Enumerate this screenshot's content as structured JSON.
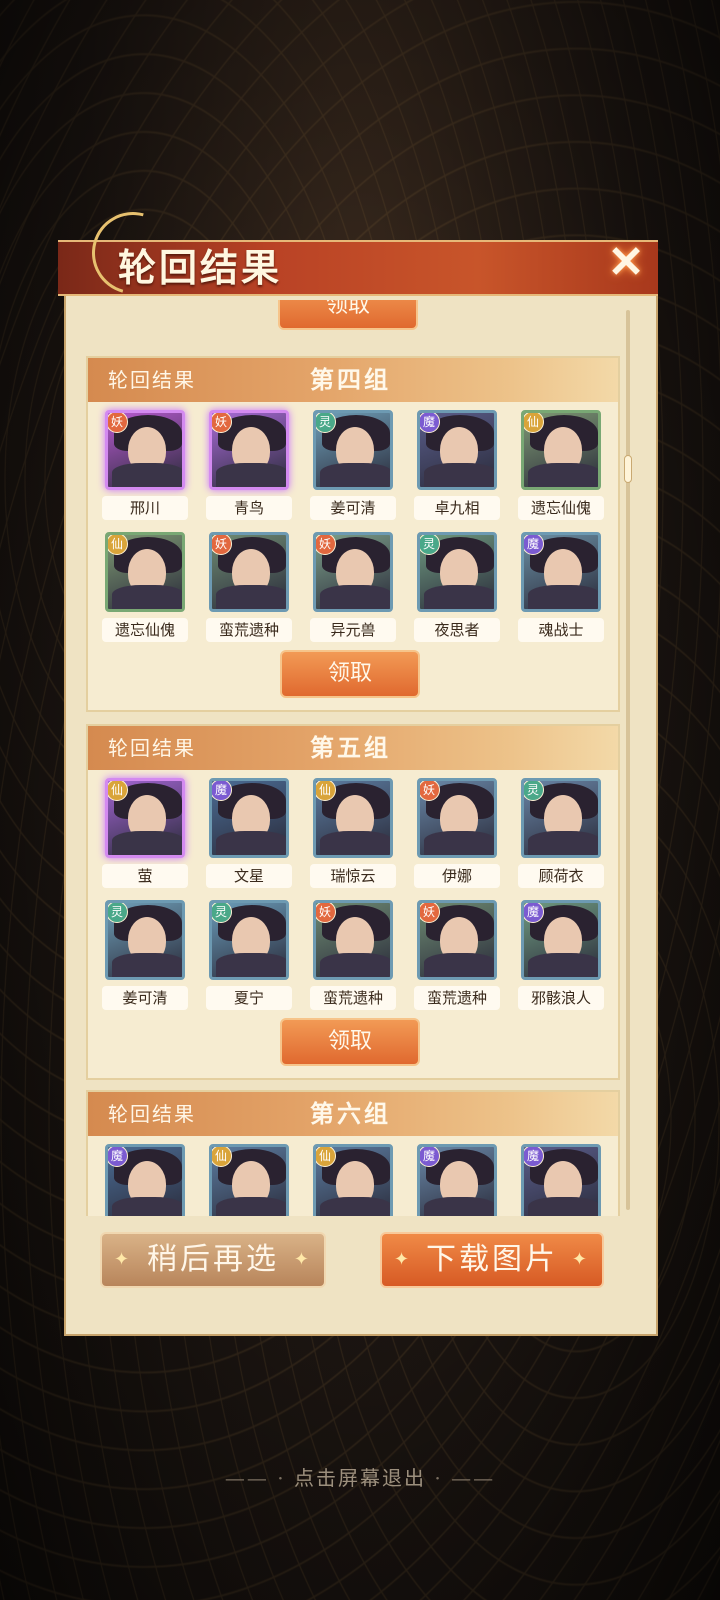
{
  "dialog": {
    "title": "轮回结果",
    "close_icon": "close-icon",
    "prev_button_label": "领取"
  },
  "groups": [
    {
      "label": "轮回结果",
      "name": "第四组",
      "claim_label": "领取",
      "members": [
        {
          "name": "邢川",
          "badge": "妖",
          "color": "#b75ad0"
        },
        {
          "name": "青鸟",
          "badge": "妖",
          "color": "#a86ad6"
        },
        {
          "name": "姜可清",
          "badge": "灵",
          "color": "#6f9fb8"
        },
        {
          "name": "卓九相",
          "badge": "魔",
          "color": "#5a5d8a"
        },
        {
          "name": "遗忘仙傀",
          "badge": "仙",
          "color": "#7f9a74"
        },
        {
          "name": "遗忘仙傀",
          "badge": "仙",
          "color": "#7f9a74"
        },
        {
          "name": "蛮荒遗种",
          "badge": "妖",
          "color": "#6f8c73"
        },
        {
          "name": "异元兽",
          "badge": "妖",
          "color": "#7da08a"
        },
        {
          "name": "夜思者",
          "badge": "灵",
          "color": "#6f9a80"
        },
        {
          "name": "魂战士",
          "badge": "魔",
          "color": "#6b8fa4"
        }
      ]
    },
    {
      "label": "轮回结果",
      "name": "第五组",
      "claim_label": "领取",
      "members": [
        {
          "name": "萤",
          "badge": "仙",
          "color": "#a265d2"
        },
        {
          "name": "文星",
          "badge": "魔",
          "color": "#4b6c94"
        },
        {
          "name": "瑞惊云",
          "badge": "仙",
          "color": "#5c7ca0"
        },
        {
          "name": "伊娜",
          "badge": "妖",
          "color": "#6a88a8"
        },
        {
          "name": "顾荷衣",
          "badge": "灵",
          "color": "#6985a6"
        },
        {
          "name": "姜可清",
          "badge": "灵",
          "color": "#6f9fb8"
        },
        {
          "name": "夏宁",
          "badge": "灵",
          "color": "#6a9bb8"
        },
        {
          "name": "蛮荒遗种",
          "badge": "妖",
          "color": "#6f8c73"
        },
        {
          "name": "蛮荒遗种",
          "badge": "妖",
          "color": "#6f8c73"
        },
        {
          "name": "邪骸浪人",
          "badge": "魔",
          "color": "#6f9a80"
        }
      ]
    },
    {
      "label": "轮回结果",
      "name": "第六组",
      "members": [
        {
          "name": "",
          "badge": "魔",
          "color": "#4b6c94"
        },
        {
          "name": "",
          "badge": "仙",
          "color": "#5c7ca0"
        },
        {
          "name": "",
          "badge": "仙",
          "color": "#5c7ca0"
        },
        {
          "name": "",
          "badge": "魔",
          "color": "#6a88a8"
        },
        {
          "name": "",
          "badge": "魔",
          "color": "#5a5d8a"
        }
      ]
    }
  ],
  "footer": {
    "later_label": "稍后再选",
    "download_label": "下载图片"
  },
  "exit_hint": "点击屏幕退出",
  "badge_colors": {
    "妖": "#e2683f",
    "灵": "#4aa889",
    "魔": "#7b5bd1",
    "仙": "#d9a43a"
  }
}
